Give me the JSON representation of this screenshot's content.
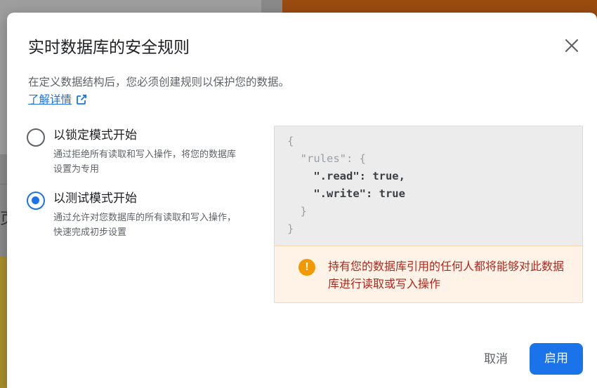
{
  "background": {
    "partial_char": "页"
  },
  "dialog": {
    "title": "实时数据库的安全规则",
    "description": "在定义数据结构后，您必须创建规则以保护您的数据。",
    "learn_more": "了解详情",
    "close_icon": "close-icon",
    "options": [
      {
        "label": "以锁定模式开始",
        "description": "通过拒绝所有读取和写入操作，将您的数据库设置为专用",
        "checked": false
      },
      {
        "label": "以测试模式开始",
        "description": "通过允许对您数据库的所有读取和写入操作，快速完成初步设置",
        "checked": true
      }
    ],
    "code": {
      "open_brace": "{",
      "rules_key": "  \"rules\": {",
      "read_line": "    \".read\": true,",
      "write_line": "    \".write\": true",
      "inner_close": "  }",
      "outer_close": "}"
    },
    "warning": {
      "icon": "!",
      "text": "持有您的数据库引用的任何人都将能够对此数据库进行读取或写入操作"
    },
    "buttons": {
      "cancel": "取消",
      "enable": "启用"
    },
    "colors": {
      "accent": "#1a73e8",
      "warning_icon": "#f29900",
      "warning_text": "#b3261e",
      "warning_bg": "#fef3e6"
    }
  }
}
